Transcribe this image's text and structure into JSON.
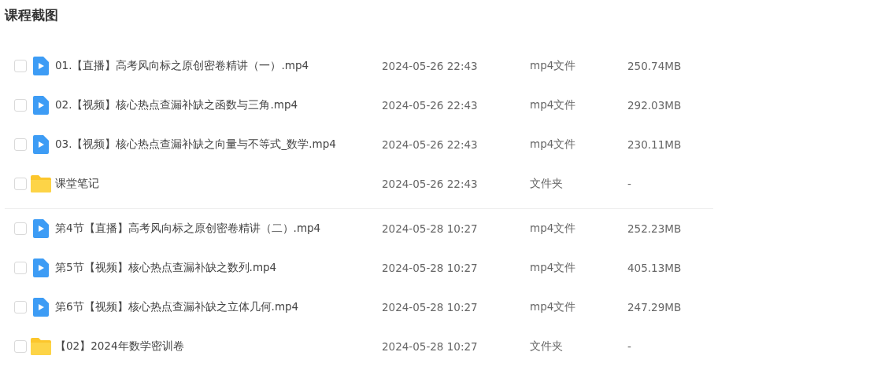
{
  "title": "课程截图",
  "groups": [
    {
      "rows": [
        {
          "kind": "video",
          "checked": false,
          "name": "01.【直播】高考风向标之原创密卷精讲（一）.mp4",
          "date": "2024-05-26 22:43",
          "type": "mp4文件",
          "size": "250.74MB"
        },
        {
          "kind": "video",
          "checked": false,
          "name": "02.【视频】核心热点查漏补缺之函数与三角.mp4",
          "date": "2024-05-26 22:43",
          "type": "mp4文件",
          "size": "292.03MB"
        },
        {
          "kind": "video",
          "checked": false,
          "name": "03.【视频】核心热点查漏补缺之向量与不等式_数学.mp4",
          "date": "2024-05-26 22:43",
          "type": "mp4文件",
          "size": "230.11MB"
        },
        {
          "kind": "folder",
          "checked": false,
          "name": "课堂笔记",
          "date": "2024-05-26 22:43",
          "type": "文件夹",
          "size": "-"
        }
      ]
    },
    {
      "rows": [
        {
          "kind": "video",
          "checked": false,
          "name": "第4节【直播】高考风向标之原创密卷精讲（二）.mp4",
          "date": "2024-05-28 10:27",
          "type": "mp4文件",
          "size": "252.23MB"
        },
        {
          "kind": "video",
          "checked": false,
          "name": "第5节【视频】核心热点查漏补缺之数列.mp4",
          "date": "2024-05-28 10:27",
          "type": "mp4文件",
          "size": "405.13MB"
        },
        {
          "kind": "video",
          "checked": false,
          "name": "第6节【视频】核心热点查漏补缺之立体几何.mp4",
          "date": "2024-05-28 10:27",
          "type": "mp4文件",
          "size": "247.29MB"
        },
        {
          "kind": "folder",
          "checked": false,
          "name": "【02】2024年数学密训卷",
          "date": "2024-05-28 10:27",
          "type": "文件夹",
          "size": "-"
        }
      ]
    }
  ]
}
